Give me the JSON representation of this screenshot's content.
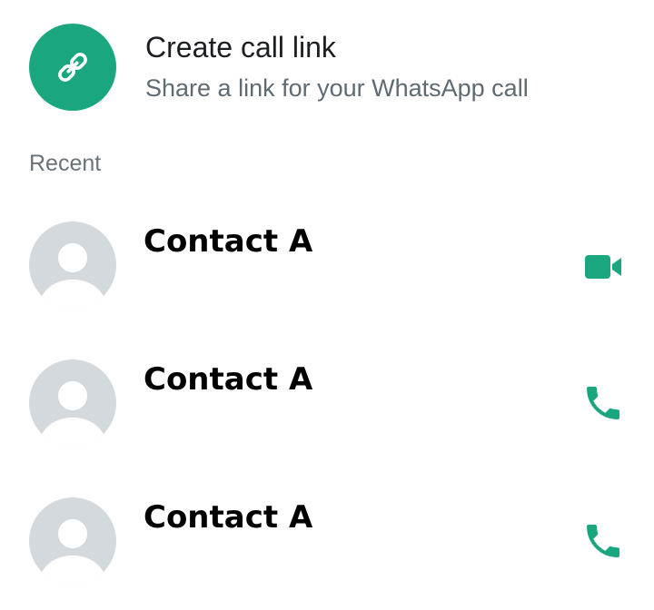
{
  "create_link": {
    "title": "Create call link",
    "subtitle": "Share a link for your WhatsApp call",
    "icon": "link-icon",
    "avatar_color": "#1aa67f"
  },
  "recent": {
    "header": "Recent",
    "calls": [
      {
        "name": "Contact A",
        "call_type": "video",
        "icon": "video-call-icon"
      },
      {
        "name": "Contact A",
        "call_type": "voice",
        "icon": "phone-call-icon"
      },
      {
        "name": "Contact A",
        "call_type": "voice",
        "icon": "phone-call-icon"
      }
    ]
  },
  "colors": {
    "accent": "#1aa67f",
    "title_text": "#1c1e21",
    "secondary_text": "#5f6b73",
    "avatar_placeholder": "#d4d9de"
  }
}
